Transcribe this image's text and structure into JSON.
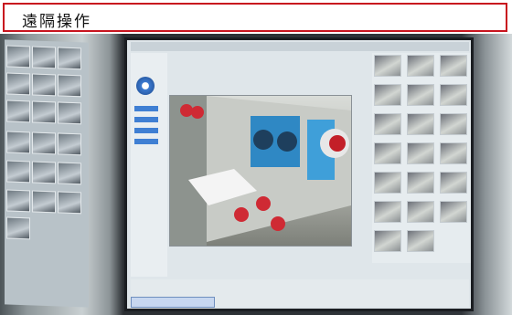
{
  "title": "遠隔操作",
  "colors": {
    "title_border": "#c8141e",
    "accent_blue": "#3f7fd3"
  },
  "icons": [
    "camera-thumbnail-icon",
    "ptz-control-icon"
  ]
}
